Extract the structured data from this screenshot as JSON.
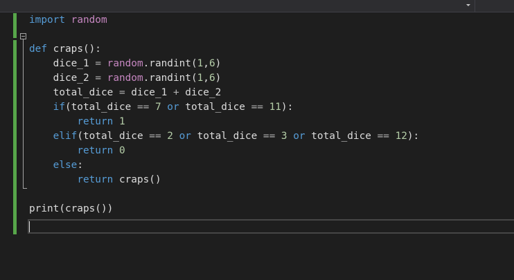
{
  "editor": {
    "lines": [
      {
        "tokens": [
          {
            "t": "import",
            "c": "kw"
          },
          {
            "t": " "
          },
          {
            "t": "random",
            "c": "mod"
          }
        ]
      },
      {
        "tokens": []
      },
      {
        "tokens": [
          {
            "t": "def",
            "c": "kw"
          },
          {
            "t": " craps():"
          }
        ]
      },
      {
        "tokens": [
          {
            "t": "    dice_1 "
          },
          {
            "t": "=",
            "c": "op"
          },
          {
            "t": " "
          },
          {
            "t": "random",
            "c": "mod"
          },
          {
            "t": ".randint("
          },
          {
            "t": "1",
            "c": "num"
          },
          {
            "t": ","
          },
          {
            "t": "6",
            "c": "num"
          },
          {
            "t": ")"
          }
        ]
      },
      {
        "tokens": [
          {
            "t": "    dice_2 "
          },
          {
            "t": "=",
            "c": "op"
          },
          {
            "t": " "
          },
          {
            "t": "random",
            "c": "mod"
          },
          {
            "t": ".randint("
          },
          {
            "t": "1",
            "c": "num"
          },
          {
            "t": ","
          },
          {
            "t": "6",
            "c": "num"
          },
          {
            "t": ")"
          }
        ]
      },
      {
        "tokens": [
          {
            "t": "    total_dice "
          },
          {
            "t": "=",
            "c": "op"
          },
          {
            "t": " dice_1 "
          },
          {
            "t": "+",
            "c": "op"
          },
          {
            "t": " dice_2"
          }
        ]
      },
      {
        "tokens": [
          {
            "t": "    "
          },
          {
            "t": "if",
            "c": "kw"
          },
          {
            "t": "(total_dice "
          },
          {
            "t": "==",
            "c": "op"
          },
          {
            "t": " "
          },
          {
            "t": "7",
            "c": "num"
          },
          {
            "t": " "
          },
          {
            "t": "or",
            "c": "kw"
          },
          {
            "t": " total_dice "
          },
          {
            "t": "==",
            "c": "op"
          },
          {
            "t": " "
          },
          {
            "t": "11",
            "c": "num"
          },
          {
            "t": "):"
          }
        ]
      },
      {
        "tokens": [
          {
            "t": "        "
          },
          {
            "t": "return",
            "c": "kw"
          },
          {
            "t": " "
          },
          {
            "t": "1",
            "c": "num"
          }
        ]
      },
      {
        "tokens": [
          {
            "t": "    "
          },
          {
            "t": "elif",
            "c": "kw"
          },
          {
            "t": "(total_dice "
          },
          {
            "t": "==",
            "c": "op"
          },
          {
            "t": " "
          },
          {
            "t": "2",
            "c": "num"
          },
          {
            "t": " "
          },
          {
            "t": "or",
            "c": "kw"
          },
          {
            "t": " total_dice "
          },
          {
            "t": "==",
            "c": "op"
          },
          {
            "t": " "
          },
          {
            "t": "3",
            "c": "num"
          },
          {
            "t": " "
          },
          {
            "t": "or",
            "c": "kw"
          },
          {
            "t": " total_dice "
          },
          {
            "t": "==",
            "c": "op"
          },
          {
            "t": " "
          },
          {
            "t": "12",
            "c": "num"
          },
          {
            "t": "):"
          }
        ]
      },
      {
        "tokens": [
          {
            "t": "        "
          },
          {
            "t": "return",
            "c": "kw"
          },
          {
            "t": " "
          },
          {
            "t": "0",
            "c": "num"
          }
        ]
      },
      {
        "tokens": [
          {
            "t": "    "
          },
          {
            "t": "else",
            "c": "kw"
          },
          {
            "t": ":"
          }
        ]
      },
      {
        "tokens": [
          {
            "t": "        "
          },
          {
            "t": "return",
            "c": "kw"
          },
          {
            "t": " craps()"
          }
        ]
      },
      {
        "tokens": []
      },
      {
        "tokens": [
          {
            "t": "print(craps())"
          }
        ]
      },
      {
        "tokens": []
      }
    ]
  },
  "colors": {
    "background": "#1e1e1e",
    "keyword": "#569cd6",
    "module": "#c586c0",
    "number": "#b5cea8",
    "text": "#dcdcdc",
    "change_bar": "#57a64a"
  },
  "icons": {
    "dropdown": "chevron-down-icon",
    "fold": "collapse-minus-icon"
  }
}
